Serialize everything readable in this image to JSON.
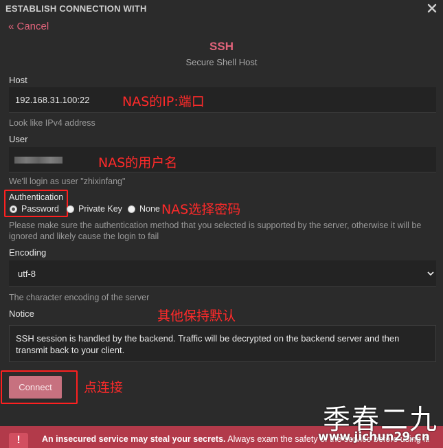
{
  "header": {
    "title": "ESTABLISH CONNECTION WITH",
    "cancel_label": "« Cancel"
  },
  "service": {
    "name": "SSH",
    "subtitle": "Secure Shell Host"
  },
  "host": {
    "label": "Host",
    "value": "192.168.31.100:22",
    "hint": "Look like IPv4 address"
  },
  "user": {
    "label": "User",
    "value": "",
    "hint": "We'll login as user \"zhixinfang\""
  },
  "auth": {
    "label": "Authentication",
    "options": [
      "Password",
      "Private Key",
      "None"
    ],
    "selected": "Password",
    "hint": "Please make sure the authentication method that you selected is supported by the server, otherwise it will be ignored and likely cause the login to fail"
  },
  "encoding": {
    "label": "Encoding",
    "value": "utf-8",
    "hint": "The character encoding of the server"
  },
  "notice": {
    "label": "Notice",
    "text": "SSH session is handled by the backend. Traffic will be decrypted on the backend server and then transmit back to your client."
  },
  "connect_label": "Connect",
  "warning": {
    "icon": "!",
    "bold": "An insecured service may steal your secrets.",
    "text": " Always exam the safety of the service before using it."
  },
  "annotations": {
    "host": "NAS的IP:端口",
    "user": "NAS的用户名",
    "auth": "NAS选择密码",
    "other": "其他保持默认",
    "connect": "点连接"
  },
  "watermark": {
    "title": "季春二九",
    "url": "www.jichun29.cn"
  },
  "colors": {
    "accent": "#e0637a",
    "annotation": "#ff2a2a",
    "warning_bg": "#b23a4a",
    "button": "#c7717f"
  }
}
